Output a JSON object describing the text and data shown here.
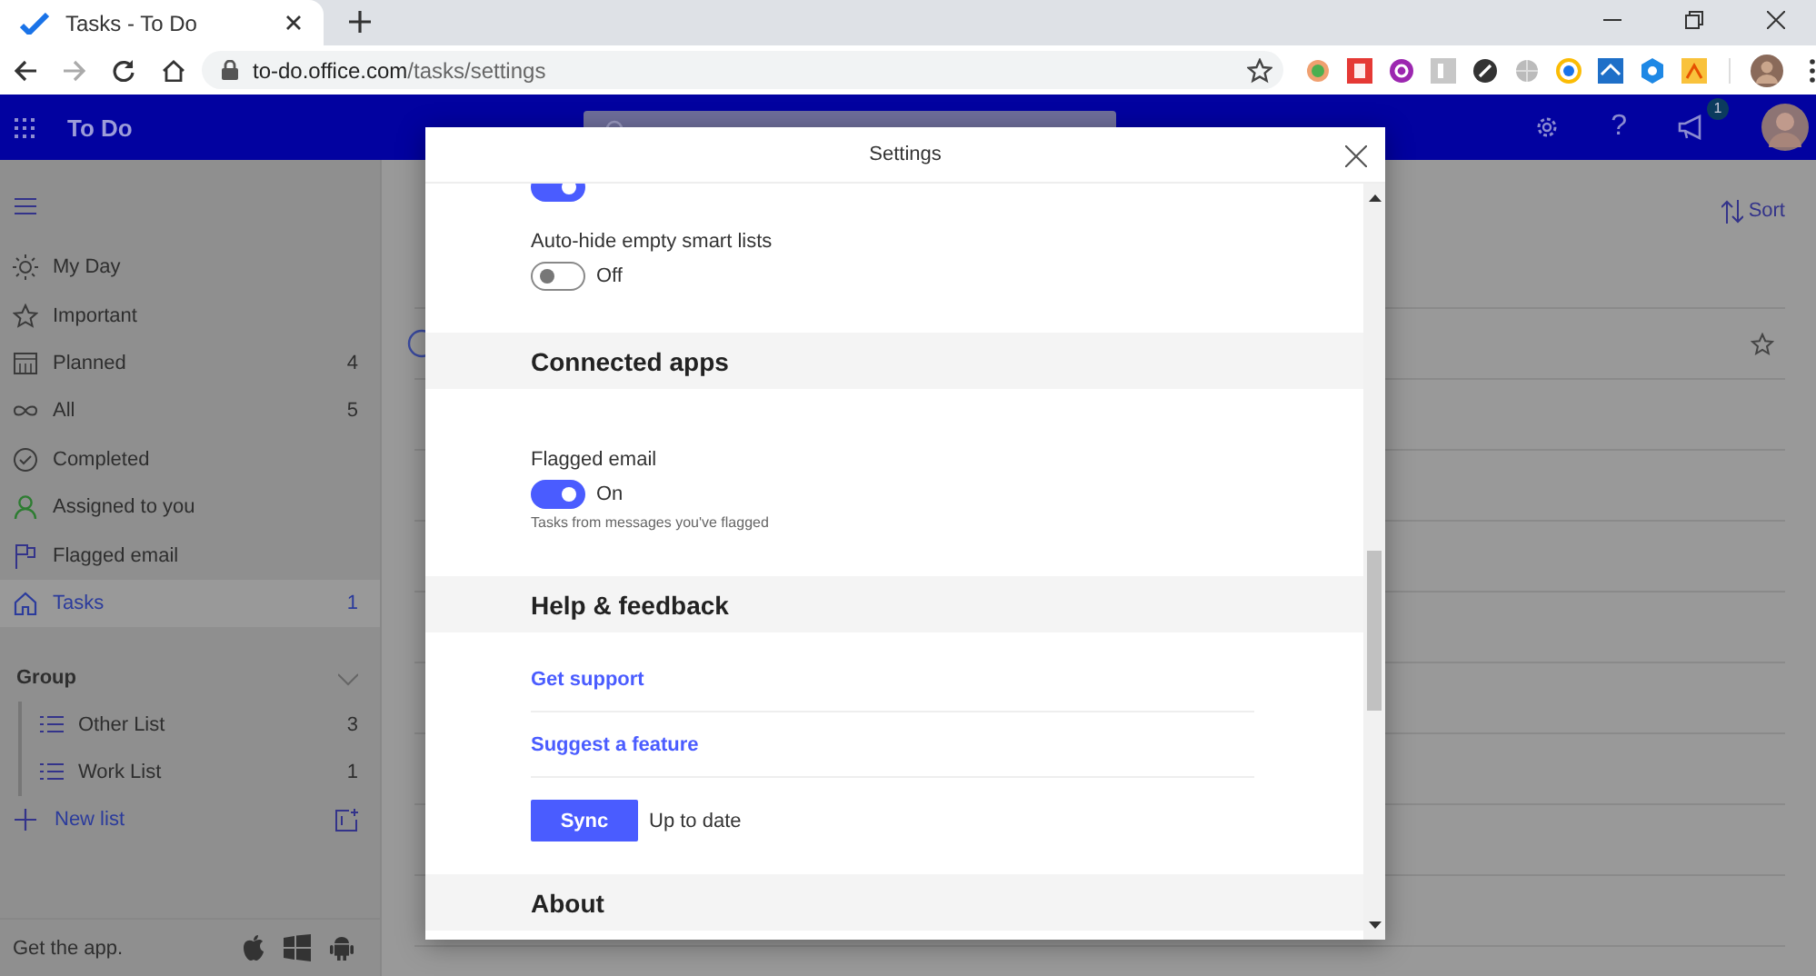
{
  "browser": {
    "tab": {
      "title": "Tasks - To Do"
    },
    "url": {
      "domain": "to-do.office.com",
      "path": "/tasks/settings"
    }
  },
  "app_bar": {
    "title": "To Do",
    "help": "?",
    "badge": "1"
  },
  "sidebar": {
    "items": [
      {
        "label": "My Day",
        "selected": false
      },
      {
        "label": "Important",
        "selected": false
      },
      {
        "label": "Planned",
        "count": "4",
        "selected": false
      },
      {
        "label": "All",
        "count": "5",
        "selected": false
      },
      {
        "label": "Completed",
        "selected": false
      },
      {
        "label": "Assigned to you",
        "selected": false
      },
      {
        "label": "Flagged email",
        "selected": false
      },
      {
        "label": "Tasks",
        "count": "1",
        "selected": true
      }
    ],
    "group": {
      "label": "Group",
      "expanded": true,
      "lists": [
        {
          "label": "Other List",
          "count": "3",
          "selected": false
        },
        {
          "label": "Work List",
          "count": "1",
          "selected": false
        }
      ]
    },
    "new_list": "New list",
    "footer": "Get the app."
  },
  "main": {
    "sort": "Sort"
  },
  "settings": {
    "title": "Settings",
    "items": [
      {
        "kind": "toggle",
        "on": true
      },
      {
        "kind": "toggle",
        "label": "Auto-hide empty smart lists",
        "on": false,
        "state": "Off"
      },
      {
        "kind": "section",
        "heading": "Connected apps"
      },
      {
        "kind": "toggle",
        "label": "Flagged email",
        "on": true,
        "state": "On",
        "hint": "Tasks from messages you've flagged"
      },
      {
        "kind": "section",
        "heading": "Help & feedback"
      },
      {
        "kind": "link",
        "label": "Get support"
      },
      {
        "kind": "link",
        "label": "Suggest a feature"
      },
      {
        "kind": "sync",
        "button": "Sync",
        "status": "Up to date"
      },
      {
        "kind": "section",
        "heading": "About"
      }
    ]
  }
}
